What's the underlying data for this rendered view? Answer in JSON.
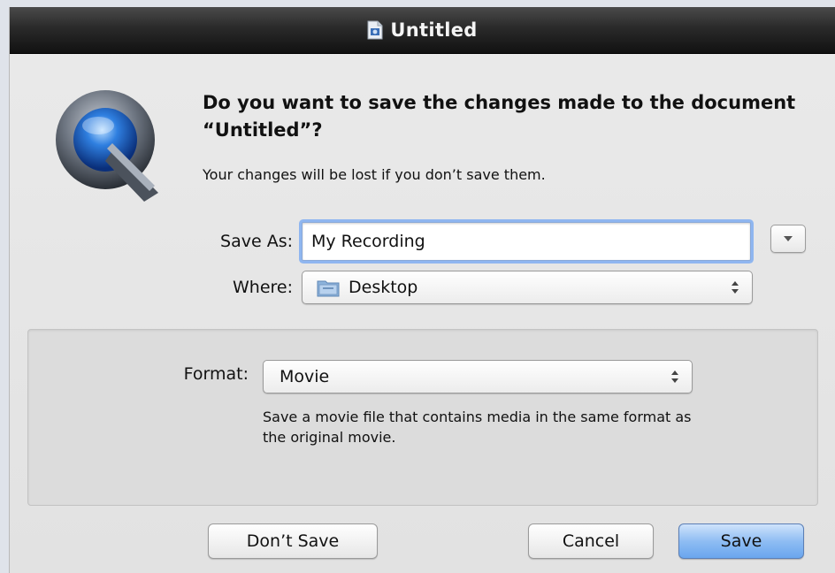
{
  "window": {
    "title": "Untitled"
  },
  "dialog": {
    "headline": "Do you want to save the changes made to the document “Untitled”?",
    "subtext": "Your changes will be lost if you don’t save them.",
    "save_as_label": "Save As:",
    "save_as_value": "My Recording",
    "where_label": "Where:",
    "where_value": "Desktop",
    "format_label": "Format:",
    "format_value": "Movie",
    "format_description": "Save a movie file that contains media in the same format as the original movie."
  },
  "buttons": {
    "dont_save": "Don’t Save",
    "cancel": "Cancel",
    "save": "Save"
  },
  "icons": {
    "app": "quicktime-icon",
    "document": "document-icon",
    "folder": "folder-icon",
    "disclosure": "triangle-down-icon",
    "popup": "updown-arrows-icon"
  },
  "colors": {
    "default_button": "#8fbdf3",
    "focus_ring": "#8fb6f0",
    "titlebar": "#2a2a2a"
  }
}
